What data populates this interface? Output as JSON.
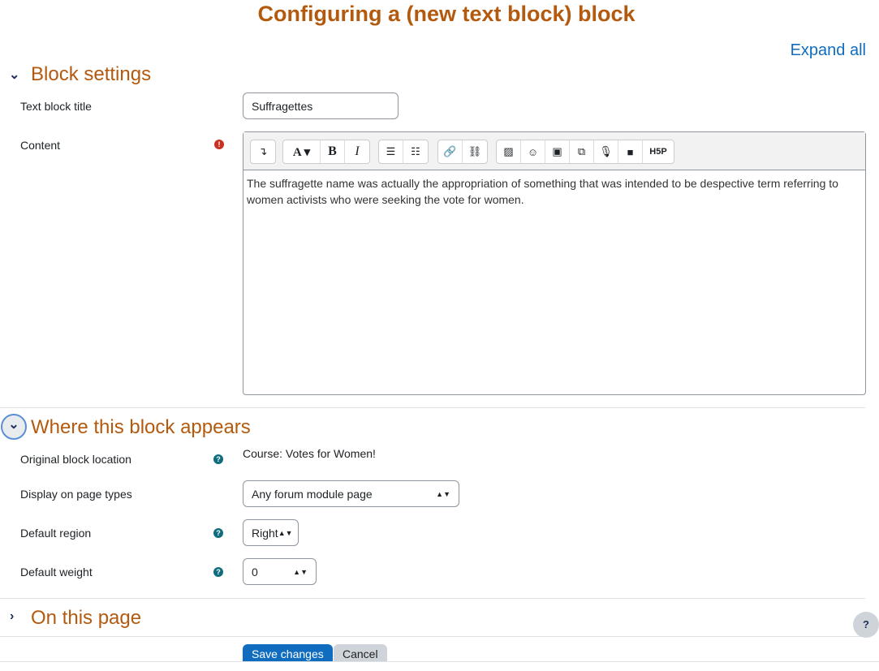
{
  "title": "Configuring a (new text block) block",
  "expand_all": "Expand all",
  "block_settings": {
    "heading": "Block settings",
    "title_label": "Text block title",
    "title_value": "Suffragettes",
    "content_label": "Content",
    "content_text": "The suffragette name was actually the appropriation of something that was intended to be despective term referring to women activists who were seeking the vote for women.",
    "toolbar": [
      [
        "collapse-icon"
      ],
      [
        "font-style-icon",
        "bold-icon",
        "italic-icon"
      ],
      [
        "unordered-list-icon",
        "ordered-list-icon"
      ],
      [
        "link-icon",
        "unlink-icon"
      ],
      [
        "image-icon",
        "emoji-icon",
        "media-icon",
        "manage-files-icon",
        "record-audio-icon",
        "record-video-icon",
        "h5p-icon"
      ]
    ]
  },
  "where": {
    "heading": "Where this block appears",
    "original_label": "Original block location",
    "original_value": "Course: Votes for Women!",
    "pagetypes_label": "Display on page types",
    "pagetypes_value": "Any forum module page",
    "region_label": "Default region",
    "region_value": "Right",
    "weight_label": "Default weight",
    "weight_value": "0"
  },
  "on_this_page": {
    "heading": "On this page"
  },
  "buttons": {
    "save": "Save changes",
    "cancel": "Cancel"
  },
  "help_fab": "?",
  "colors": {
    "accent": "#b35a0f",
    "primary": "#0f6cbf"
  }
}
